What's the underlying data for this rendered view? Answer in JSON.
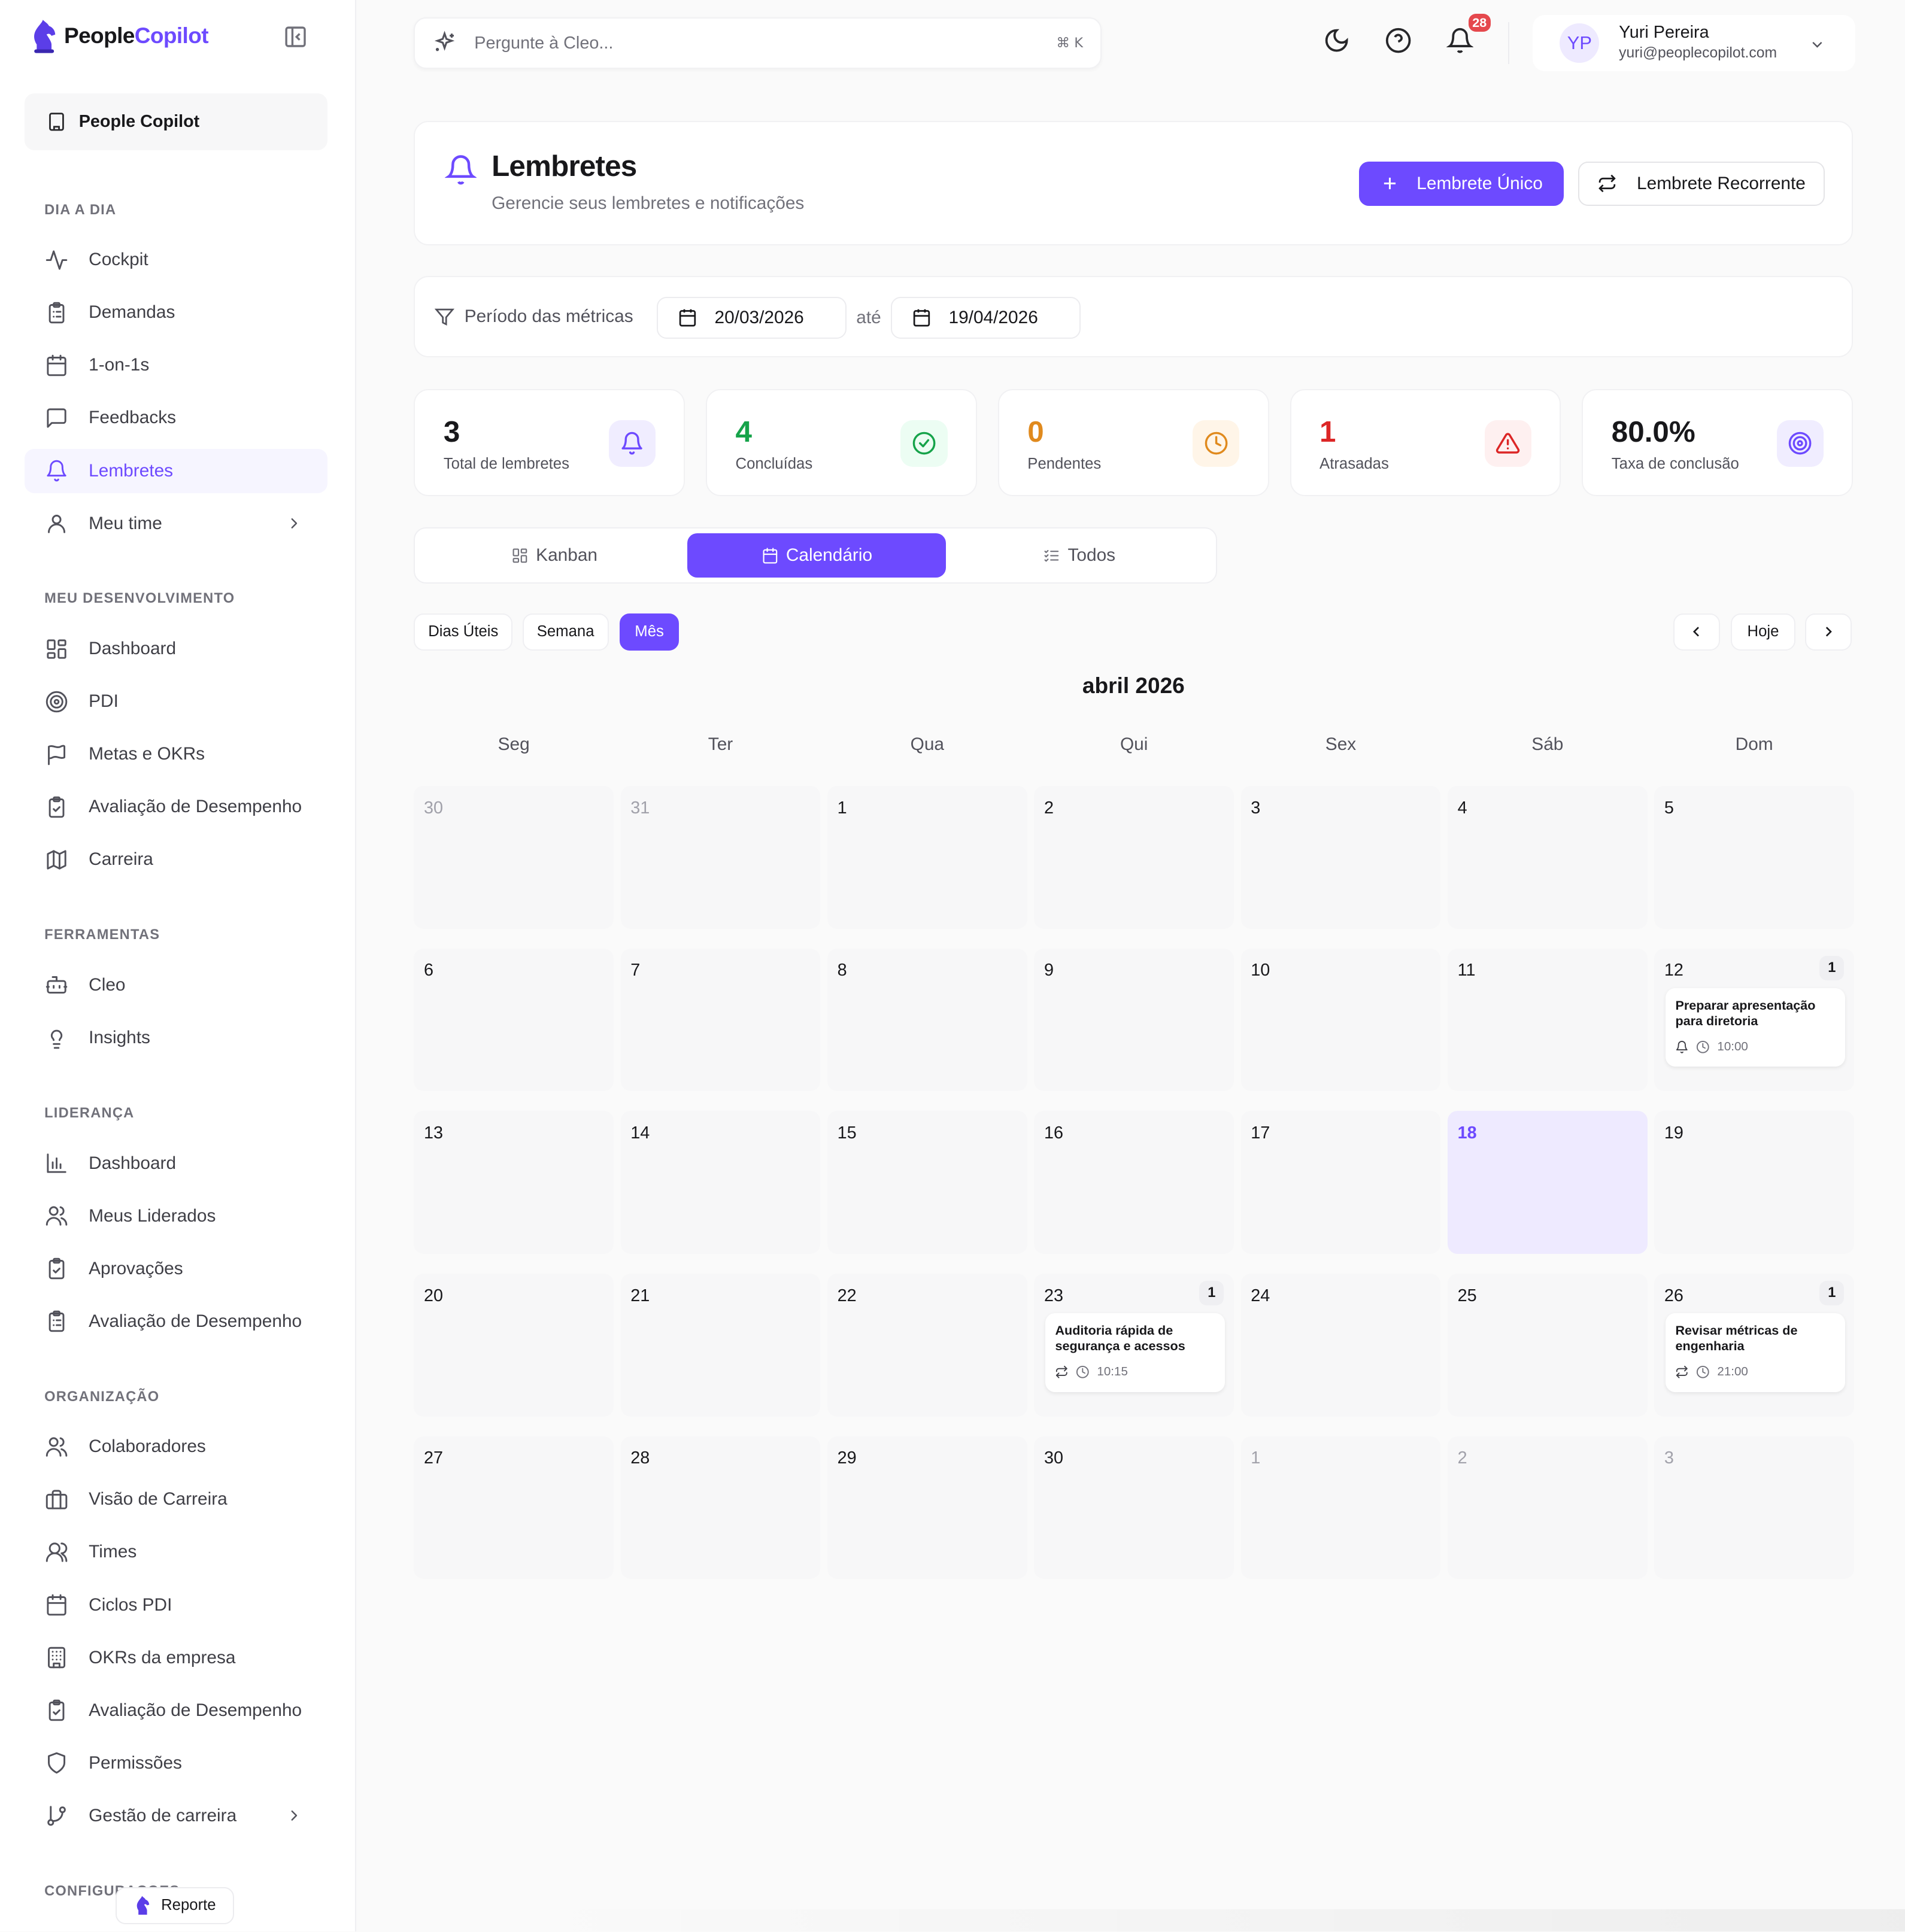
{
  "app": {
    "name_part1": "People",
    "name_part2": "Copilot",
    "org": "People Copilot"
  },
  "sidebar": {
    "sections": [
      {
        "title": "DIA A DIA",
        "items": [
          {
            "label": "Cockpit",
            "icon": "activity-icon"
          },
          {
            "label": "Demandas",
            "icon": "clipboard-list-icon"
          },
          {
            "label": "1-on-1s",
            "icon": "calendar-icon"
          },
          {
            "label": "Feedbacks",
            "icon": "message-square-icon"
          },
          {
            "label": "Lembretes",
            "icon": "bell-icon",
            "active": true
          },
          {
            "label": "Meu time",
            "icon": "user-icon",
            "chevron": true
          }
        ]
      },
      {
        "title": "MEU DESENVOLVIMENTO",
        "items": [
          {
            "label": "Dashboard",
            "icon": "layout-grid-icon"
          },
          {
            "label": "PDI",
            "icon": "target-icon"
          },
          {
            "label": "Metas e OKRs",
            "icon": "flag-icon"
          },
          {
            "label": "Avaliação de Desempenho",
            "icon": "clipboard-check-icon"
          },
          {
            "label": "Carreira",
            "icon": "map-icon"
          }
        ]
      },
      {
        "title": "FERRAMENTAS",
        "items": [
          {
            "label": "Cleo",
            "icon": "bot-icon"
          },
          {
            "label": "Insights",
            "icon": "lightbulb-icon"
          }
        ]
      },
      {
        "title": "LIDERANÇA",
        "items": [
          {
            "label": "Dashboard",
            "icon": "bar-chart-icon"
          },
          {
            "label": "Meus Liderados",
            "icon": "users-icon"
          },
          {
            "label": "Aprovações",
            "icon": "clipboard-check-icon"
          },
          {
            "label": "Avaliação de Desempenho",
            "icon": "clipboard-list-icon"
          }
        ]
      },
      {
        "title": "ORGANIZAÇÃO",
        "items": [
          {
            "label": "Colaboradores",
            "icon": "users-icon"
          },
          {
            "label": "Visão de Carreira",
            "icon": "briefcase-icon"
          },
          {
            "label": "Times",
            "icon": "users-round-icon"
          },
          {
            "label": "Ciclos PDI",
            "icon": "calendar-icon"
          },
          {
            "label": "OKRs da empresa",
            "icon": "building-icon"
          },
          {
            "label": "Avaliação de Desempenho",
            "icon": "clipboard-check-icon"
          },
          {
            "label": "Permissões",
            "icon": "shield-icon"
          },
          {
            "label": "Gestão de carreira",
            "icon": "git-branch-icon",
            "chevron": true
          }
        ]
      },
      {
        "title": "CONFIGURAÇÕES",
        "items": []
      }
    ],
    "report_label": "Reporte"
  },
  "topbar": {
    "search_placeholder": "Pergunte à Cleo...",
    "shortcut": "⌘ K",
    "notifications_count": "28",
    "user": {
      "initials": "YP",
      "name": "Yuri Pereira",
      "email": "yuri@peoplecopilot.com"
    }
  },
  "header": {
    "title": "Lembretes",
    "subtitle": "Gerencie seus lembretes e notificações",
    "primary_button": "Lembrete Único",
    "secondary_button": "Lembrete Recorrente"
  },
  "period": {
    "label": "Período das métricas",
    "start": "20/03/2026",
    "separator": "até",
    "end": "19/04/2026"
  },
  "stats": [
    {
      "value": "3",
      "label": "Total de lembretes",
      "color": "#18181b",
      "icon": "bell-icon",
      "icon_color": "#6d4aff",
      "icon_bg": "#f0edff"
    },
    {
      "value": "4",
      "label": "Concluídas",
      "color": "#16a34a",
      "icon": "check-circle-icon",
      "icon_color": "#16a34a",
      "icon_bg": "#ecfdf3"
    },
    {
      "value": "0",
      "label": "Pendentes",
      "color": "#e08a1e",
      "icon": "clock-icon",
      "icon_color": "#e08a1e",
      "icon_bg": "#fff5e8"
    },
    {
      "value": "1",
      "label": "Atrasadas",
      "color": "#dc2626",
      "icon": "alert-triangle-icon",
      "icon_color": "#dc2626",
      "icon_bg": "#fef0f0"
    },
    {
      "value": "80.0%",
      "label": "Taxa de conclusão",
      "color": "#18181b",
      "icon": "target-icon",
      "icon_color": "#6d4aff",
      "icon_bg": "#f0edff"
    }
  ],
  "view_tabs": [
    {
      "label": "Kanban",
      "icon": "layout-grid-icon"
    },
    {
      "label": "Calendário",
      "icon": "calendar-icon",
      "active": true
    },
    {
      "label": "Todos",
      "icon": "list-checks-icon"
    }
  ],
  "range_pills": [
    {
      "label": "Dias Úteis"
    },
    {
      "label": "Semana"
    },
    {
      "label": "Mês",
      "active": true
    }
  ],
  "nav": {
    "today_label": "Hoje"
  },
  "calendar": {
    "title": "abril 2026",
    "weekdays": [
      "Seg",
      "Ter",
      "Qua",
      "Qui",
      "Sex",
      "Sáb",
      "Dom"
    ],
    "weeks": [
      [
        {
          "d": "30",
          "other": true
        },
        {
          "d": "31",
          "other": true
        },
        {
          "d": "1"
        },
        {
          "d": "2"
        },
        {
          "d": "3"
        },
        {
          "d": "4"
        },
        {
          "d": "5"
        }
      ],
      [
        {
          "d": "6"
        },
        {
          "d": "7"
        },
        {
          "d": "8"
        },
        {
          "d": "9"
        },
        {
          "d": "10"
        },
        {
          "d": "11"
        },
        {
          "d": "12",
          "count": "1",
          "events": [
            {
              "title": "Preparar apresentação para diretoria",
              "type": "bell-icon",
              "time": "10:00"
            }
          ]
        }
      ],
      [
        {
          "d": "13"
        },
        {
          "d": "14"
        },
        {
          "d": "15"
        },
        {
          "d": "16"
        },
        {
          "d": "17"
        },
        {
          "d": "18",
          "today": true
        },
        {
          "d": "19"
        }
      ],
      [
        {
          "d": "20"
        },
        {
          "d": "21"
        },
        {
          "d": "22"
        },
        {
          "d": "23",
          "count": "1",
          "events": [
            {
              "title": "Auditoria rápida de segurança e acessos",
              "type": "repeat-icon",
              "time": "10:15"
            }
          ]
        },
        {
          "d": "24"
        },
        {
          "d": "25"
        },
        {
          "d": "26",
          "count": "1",
          "events": [
            {
              "title": "Revisar métricas de engenharia",
              "type": "repeat-icon",
              "time": "21:00"
            }
          ]
        }
      ],
      [
        {
          "d": "27"
        },
        {
          "d": "28"
        },
        {
          "d": "29"
        },
        {
          "d": "30"
        },
        {
          "d": "1",
          "other": true
        },
        {
          "d": "2",
          "other": true
        },
        {
          "d": "3",
          "other": true
        }
      ]
    ]
  }
}
